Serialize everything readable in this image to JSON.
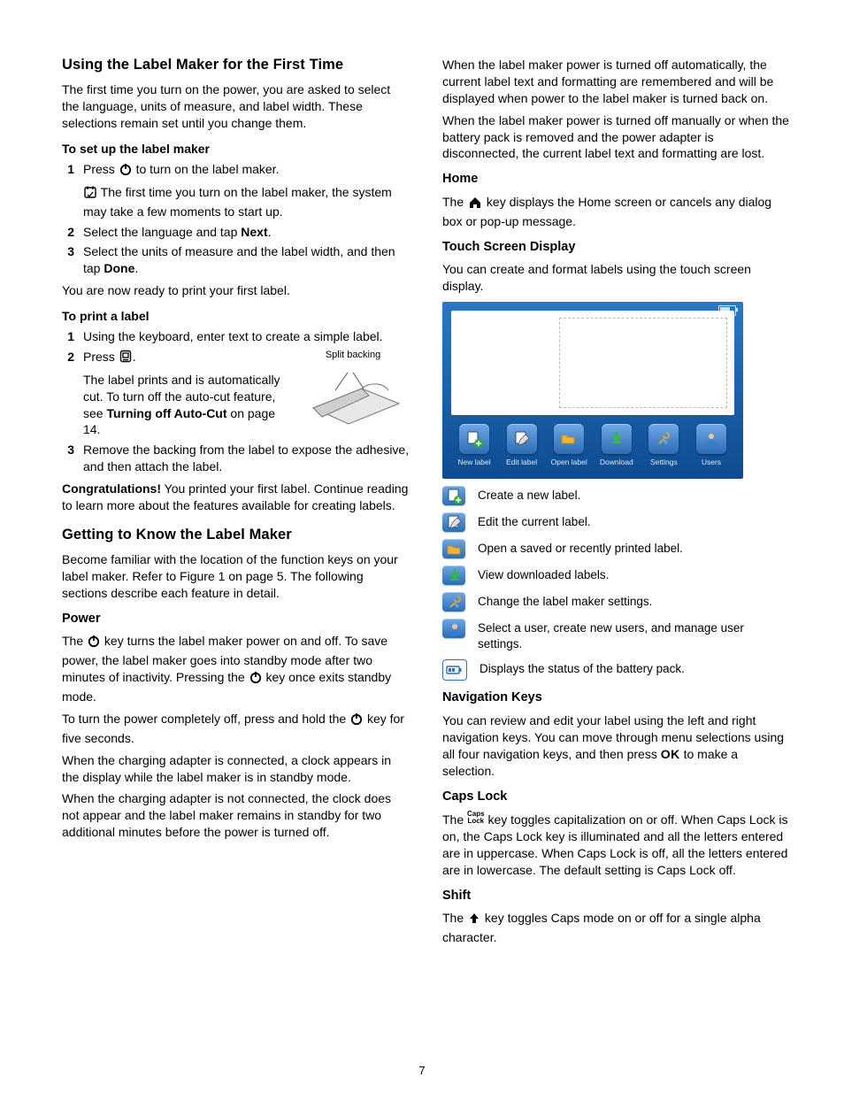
{
  "page_number": "7",
  "left": {
    "h2a": "Using the Label Maker for the First Time",
    "intro": "The first time you turn on the power, you are asked to select the language, units of measure, and label width. These selections remain set until you change them.",
    "setup_head": "To set up the label maker",
    "setup": [
      "Press  to turn on the label maker.",
      "Select the language and tap Next.",
      "Select the units of measure and the label width, and then tap Done."
    ],
    "setup_note_pre": "The first time you turn on the label maker, the system may take a few moments to start up.",
    "setup_ready": "You are now ready to print your first label.",
    "print_head": "To print a label",
    "print": [
      "Using the keyboard, enter text to create a simple label.",
      "Press .",
      "Remove the backing from the label to expose the adhesive, and then attach the label."
    ],
    "print_after_press": "The label prints and is automatically cut. To turn off the auto-cut feature, see Turning off Auto-Cut on page 14.",
    "split_caption": "Split backing",
    "congrats_b": "Congratulations!",
    "congrats_rest": " You printed your first label. Continue reading to learn more about the features available for creating labels.",
    "h2b": "Getting to Know the Label Maker",
    "know_intro": "Become familiar with the location of the function keys on your label maker. Refer to Figure 1 on page 5. The following sections describe each feature in detail.",
    "power_h": "Power",
    "power_p1a": "The ",
    "power_p1b": " key turns the label maker power on and off. To save power, the label maker goes into standby mode after two minutes of inactivity. Pressing the ",
    "power_p1c": " key once exits standby mode.",
    "power_p2a": "To turn the power completely off, press and hold the ",
    "power_p2b": " key for five seconds.",
    "power_p3": "When the charging adapter is connected, a clock appears in the display while the label maker is in standby mode.",
    "power_p4": "When the charging adapter is not connected, the clock does not appear and the label maker remains in standby for two additional minutes before the power is turned off."
  },
  "right": {
    "top1": "When the label maker power is turned off automatically, the current label text and formatting are remembered and will be displayed when power to the label maker is turned back on.",
    "top2": "When the label maker power is turned off manually or when the battery pack is removed and the power adapter is disconnected, the current label text and formatting are lost.",
    "home_h": "Home",
    "home_a": "The ",
    "home_b": " key displays the Home screen or cancels any dialog box or pop-up message.",
    "tsd_h": "Touch Screen Display",
    "tsd_p": "You can create and format labels using the touch screen display.",
    "toolbar": [
      {
        "id": "new-label",
        "label": "New label"
      },
      {
        "id": "edit-label",
        "label": "Edit label"
      },
      {
        "id": "open-label",
        "label": "Open label"
      },
      {
        "id": "download",
        "label": "Download"
      },
      {
        "id": "settings",
        "label": "Settings"
      },
      {
        "id": "users",
        "label": "Users"
      }
    ],
    "legend": [
      {
        "id": "new-label",
        "text": "Create a new label."
      },
      {
        "id": "edit-label",
        "text": "Edit the current label."
      },
      {
        "id": "open-label",
        "text": "Open a saved or recently printed label."
      },
      {
        "id": "download",
        "text": "View downloaded labels."
      },
      {
        "id": "settings",
        "text": "Change the label maker settings."
      },
      {
        "id": "users",
        "text": "Select a user, create new users, and manage user settings."
      },
      {
        "id": "battery",
        "text": "Displays the status of the battery pack."
      }
    ],
    "nav_h": "Navigation Keys",
    "nav_a": "You can review and edit your label using the left and right navigation keys. You can move through menu selections using all four navigation keys, and then press ",
    "nav_ok": "OK",
    "nav_b": " to make a selection.",
    "caps_h": "Caps Lock",
    "caps_a": "The ",
    "caps_key_top": "Caps",
    "caps_key_bot": "Lock",
    "caps_b": " key toggles capitalization on or off. When Caps Lock is on, the Caps Lock key is illuminated and all the letters entered are in uppercase. When Caps Lock is off, all the letters entered are in lowercase. The default setting is Caps Lock off.",
    "shift_h": "Shift",
    "shift_a": "The ",
    "shift_b": " key toggles Caps mode on or off for a single alpha character."
  }
}
